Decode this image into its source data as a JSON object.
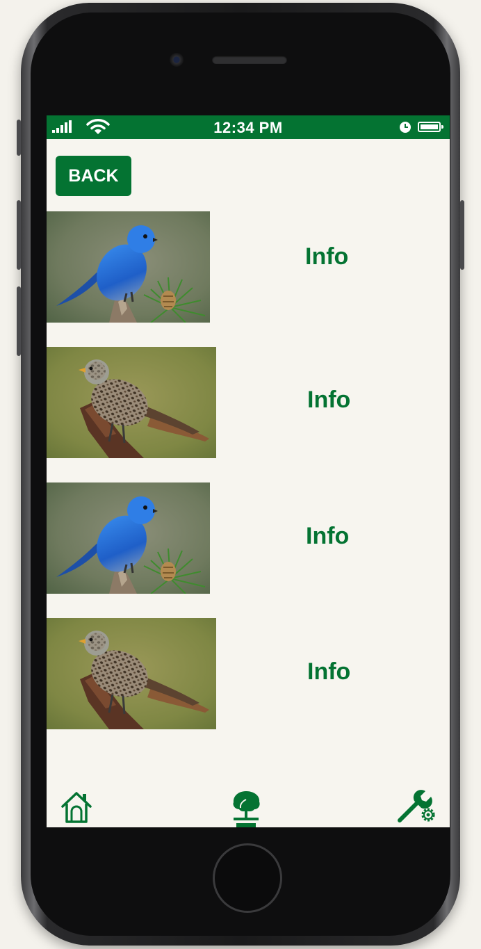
{
  "status_bar": {
    "time": "12:34 PM",
    "icons": [
      "signal-icon",
      "wifi-icon",
      "clock-icon",
      "battery-icon"
    ]
  },
  "back_button": {
    "label": "BACK"
  },
  "bird_list": [
    {
      "image": "mountain-bluebird-photo",
      "info_label": "Info"
    },
    {
      "image": "spotted-brown-bird-photo",
      "info_label": "Info"
    },
    {
      "image": "mountain-bluebird-photo",
      "info_label": "Info"
    },
    {
      "image": "spotted-brown-bird-photo",
      "info_label": "Info"
    }
  ],
  "tab_bar": {
    "items": [
      "home-icon",
      "tree-icon",
      "settings-wrench-icon"
    ]
  },
  "colors": {
    "brand_green": "#047332",
    "screen_background": "#f7f5ef"
  }
}
